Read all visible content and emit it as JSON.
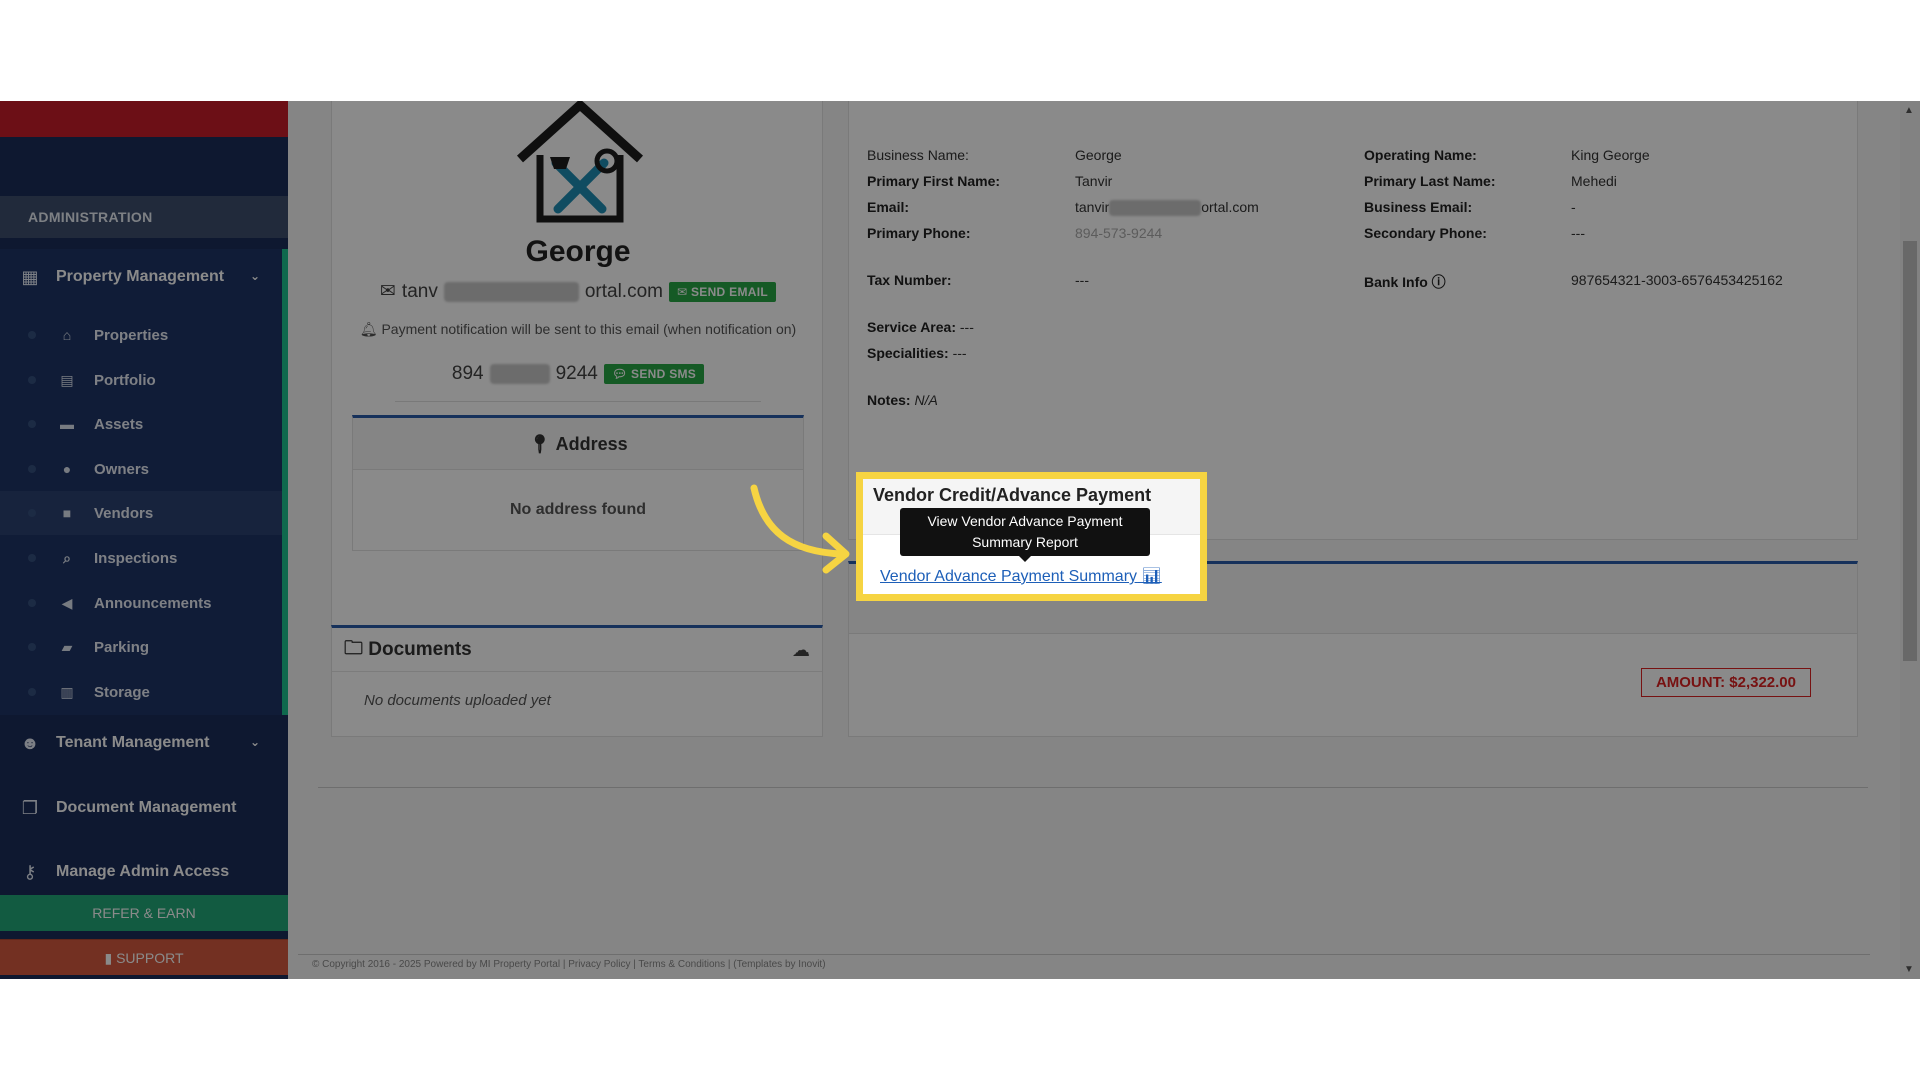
{
  "sidebar": {
    "section": "ADMINISTRATION",
    "property_management": "Property Management",
    "items": [
      {
        "label": "Properties",
        "icon": "home-icon"
      },
      {
        "label": "Portfolio",
        "icon": "building-icon"
      },
      {
        "label": "Assets",
        "icon": "archive-icon"
      },
      {
        "label": "Owners",
        "icon": "user-icon"
      },
      {
        "label": "Vendors",
        "icon": "briefcase-icon"
      },
      {
        "label": "Inspections",
        "icon": "search-icon"
      },
      {
        "label": "Announcements",
        "icon": "bullhorn-icon"
      },
      {
        "label": "Parking",
        "icon": "car-icon"
      },
      {
        "label": "Storage",
        "icon": "storage-icon"
      }
    ],
    "tenant_management": "Tenant Management",
    "document_management": "Document Management",
    "manage_admin_access": "Manage Admin Access",
    "refer": "REFER & EARN",
    "support": "SUPPORT"
  },
  "profile": {
    "name": "George",
    "email_start": "tanv",
    "email_end": "ortal.com",
    "send_email": "SEND EMAIL",
    "notification": "Payment notification will be sent to this email (when notification on)",
    "phone_start": "894",
    "phone_end": "9244",
    "send_sms": "SEND SMS",
    "address_title": "Address",
    "address_empty": "No address found",
    "documents_title": "Documents",
    "documents_empty": "No documents uploaded yet"
  },
  "info": {
    "business_name_label": "Business Name:",
    "business_name": "George",
    "operating_name_label": "Operating Name:",
    "operating_name": "King George",
    "primary_first_label": "Primary First Name:",
    "primary_first": "Tanvir",
    "primary_last_label": "Primary Last Name:",
    "primary_last": "Mehedi",
    "email_label": "Email:",
    "email_start": "tanvir",
    "email_end": "ortal.com",
    "business_email_label": "Business Email:",
    "business_email": "-",
    "primary_phone_label": "Primary Phone:",
    "primary_phone": "894-573-9244",
    "secondary_phone_label": "Secondary Phone:",
    "secondary_phone": "---",
    "tax_label": "Tax Number:",
    "tax": "---",
    "bank_label": "Bank Info",
    "bank": "987654321-3003-6576453425162",
    "service_label": "Service Area:",
    "service": "---",
    "specialities_label": "Specialities:",
    "specialities": "---",
    "notes_label": "Notes:",
    "notes": "N/A"
  },
  "vendor_credit": {
    "title": "Vendor Credit/Advance Payment",
    "tooltip": "View Vendor Advance Payment Summary Report",
    "link": "Vendor Advance Payment Summary",
    "amount": "AMOUNT: $2,322.00"
  },
  "footer": {
    "text": "© Copyright 2016 - 2025 Powered by MI Property Portal | Privacy Policy | Terms & Conditions | (Templates by Inovit)"
  },
  "colors": {
    "sidebar": "#1a2d5a",
    "highlight": "#f6d442",
    "green": "#28a745",
    "amount_red": "#dd2222"
  }
}
